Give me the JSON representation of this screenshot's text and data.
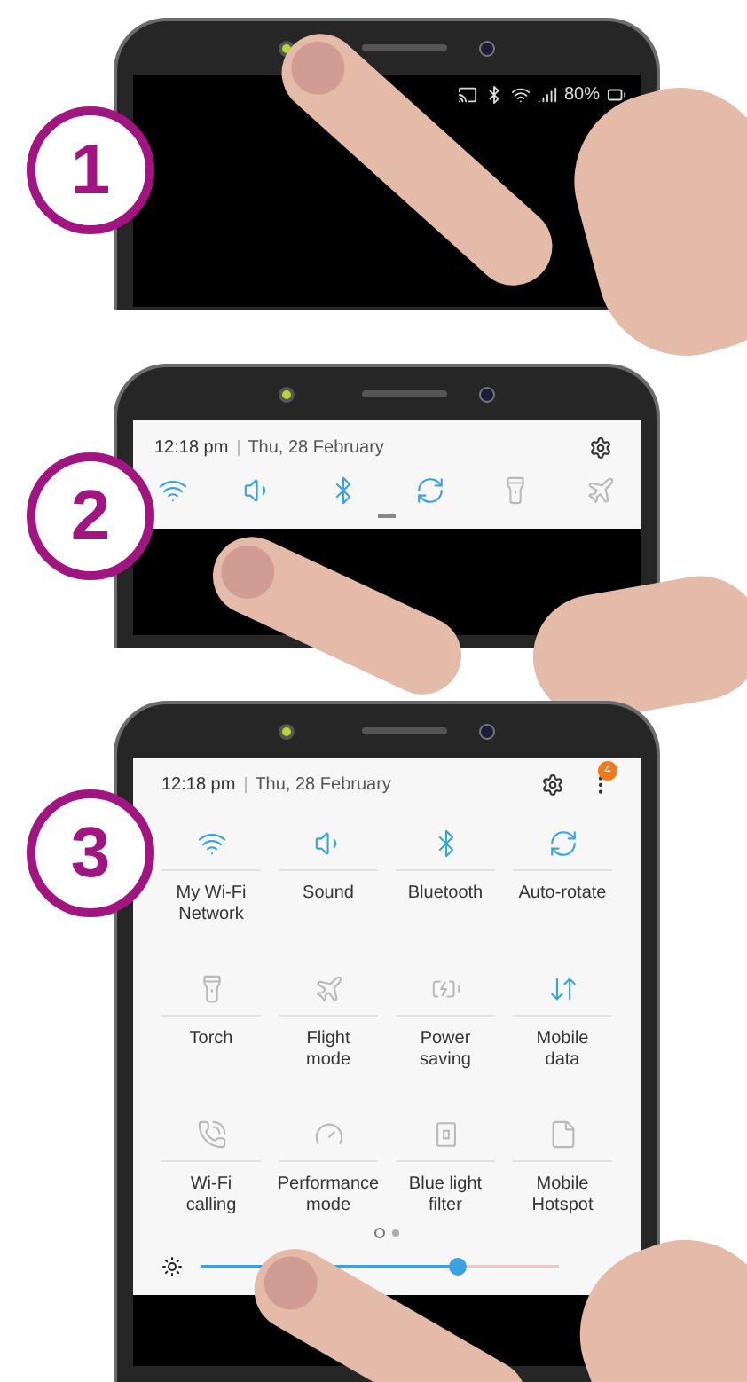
{
  "steps": [
    {
      "number": "1",
      "status_bar": {
        "battery": "80%"
      }
    },
    {
      "number": "2",
      "quick_panel": {
        "time": "12:18 pm",
        "date": "Thu, 28 February",
        "toggles": [
          {
            "kind": "wifi",
            "on": true
          },
          {
            "kind": "sound",
            "on": true
          },
          {
            "kind": "bluetooth",
            "on": true
          },
          {
            "kind": "auto_rotate",
            "on": true
          },
          {
            "kind": "torch",
            "on": false
          },
          {
            "kind": "flight",
            "on": false
          }
        ]
      }
    },
    {
      "number": "3",
      "quick_panel": {
        "time": "12:18 pm",
        "date": "Thu, 28 February",
        "notification_badge": "4",
        "tiles": [
          {
            "kind": "wifi",
            "label": "My Wi-Fi\nNetwork",
            "on": true
          },
          {
            "kind": "sound",
            "label": "Sound",
            "on": true
          },
          {
            "kind": "bluetooth",
            "label": "Bluetooth",
            "on": true
          },
          {
            "kind": "auto_rotate",
            "label": "Auto-rotate",
            "on": true
          },
          {
            "kind": "torch",
            "label": "Torch",
            "on": false
          },
          {
            "kind": "flight",
            "label": "Flight\nmode",
            "on": false
          },
          {
            "kind": "power_saving",
            "label": "Power\nsaving",
            "on": false
          },
          {
            "kind": "mobile_data",
            "label": "Mobile\ndata",
            "on": true
          },
          {
            "kind": "wifi_calling",
            "label": "Wi-Fi\ncalling",
            "on": false
          },
          {
            "kind": "performance",
            "label": "Performance\nmode",
            "on": false
          },
          {
            "kind": "blue_light",
            "label": "Blue light\nfilter",
            "on": false
          },
          {
            "kind": "hotspot",
            "label": "Mobile\nHotspot",
            "on": false
          }
        ],
        "pages": [
          {
            "selected": true
          },
          {
            "selected": false
          }
        ],
        "brightness": {
          "level": 0.72
        }
      }
    }
  ]
}
